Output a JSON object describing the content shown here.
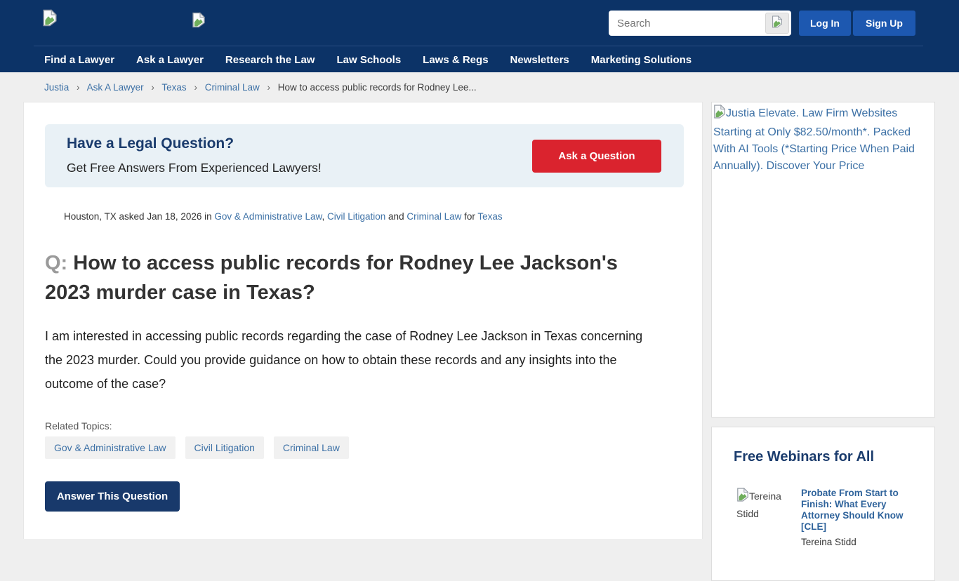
{
  "colors": {
    "header_bg": "#0c3367",
    "button_blue": "#1d58b0",
    "accent_red": "#da232e",
    "navy": "#18396b",
    "link_blue": "#3d71a6"
  },
  "header": {
    "search_placeholder": "Search",
    "login_label": "Log In",
    "signup_label": "Sign Up",
    "nav": [
      {
        "label": "Find a Lawyer"
      },
      {
        "label": "Ask a Lawyer"
      },
      {
        "label": "Research the Law"
      },
      {
        "label": "Law Schools"
      },
      {
        "label": "Laws & Regs"
      },
      {
        "label": "Newsletters"
      },
      {
        "label": "Marketing Solutions"
      }
    ]
  },
  "breadcrumb": {
    "separator": "›",
    "links": [
      "Justia",
      "Ask A Lawyer",
      "Texas",
      "Criminal Law"
    ],
    "current": "How to access public records for Rodney Lee..."
  },
  "cta": {
    "title": "Have a Legal Question?",
    "subtitle": "Get Free Answers From Experienced Lawyers!",
    "button_label": "Ask a Question"
  },
  "question": {
    "meta": {
      "prefix": "Houston, TX asked Jan 18, 2026 in ",
      "category1": "Gov & Administrative Law",
      "comma": ", ",
      "category2": "Civil Litigation",
      "and": " and ",
      "category3": "Criminal Law",
      "for_word": " for ",
      "state": "Texas"
    },
    "q_label": "Q: ",
    "title": "How to access public records for Rodney Lee Jackson's 2023 murder case in Texas?",
    "body": "I am interested in accessing public records regarding the case of Rodney Lee Jackson in Texas concerning the 2023 murder. Could you provide guidance on how to obtain these records and any insights into the outcome of the case?",
    "related_topics_label": "Related Topics:",
    "topics": [
      "Gov & Administrative Law",
      "Civil Litigation",
      "Criminal Law"
    ],
    "answer_button_label": "Answer This Question"
  },
  "sidebar": {
    "ad_alt_text": "Justia Elevate. Law Firm Websites Starting at Only $82.50/month*. Packed With AI Tools (*Starting Price When Paid Annually). Discover Your Price",
    "webinars": {
      "heading": "Free Webinars for All",
      "item": {
        "image_alt": "Tereina Stidd",
        "title": "Probate From Start to Finish: What Every Attorney Should Know [CLE]",
        "speaker": "Tereina Stidd"
      }
    }
  }
}
